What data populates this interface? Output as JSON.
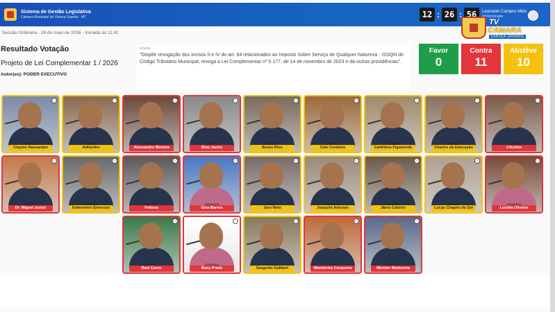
{
  "header": {
    "system_title": "Sistema de Gestão Legislativa",
    "system_subtitle": "Câmara Municipal de Várzea Grande - MT",
    "clock": {
      "h": "12",
      "m": "26",
      "s": "56"
    },
    "user_name": "Leonardo Campos Melo",
    "user_role": "Administrador",
    "tv_label": "TV",
    "tv_camara": "CÂMARA",
    "tv_city": "VÁRZEA GRANDE"
  },
  "session": {
    "info": "Sessão Ordinária - 26 de maio de 2026 - Iniciada às 11:42"
  },
  "vote": {
    "title": "Resultado Votação",
    "bill": "Projeto de Lei Complementar 1 / 2026",
    "author": "Autor(es): PODER EXECUTIVO",
    "ementa_label": "Ementa",
    "ementa": "\"Dispõe revogação dos incisos II e IV do art. 84 relacionados ao Imposto Sobre Serviço de Qualquer Natureza - ISSQN do Código Tributário Municipal, revoga a Lei Complementar nº 5.177, de 14 de novembro de 2023 e dá outras providências\"."
  },
  "tally": [
    {
      "label": "Favor",
      "count": "0",
      "color": "#1e9e4a"
    },
    {
      "label": "Contra",
      "count": "11",
      "color": "#e3353a"
    },
    {
      "label": "Abstêve",
      "count": "10",
      "color": "#f4c20d"
    }
  ],
  "role_label": "Vereador",
  "role_label_f": "Vereadora",
  "members": [
    {
      "name": "Clayton Nassarden",
      "vote": "abst",
      "bg": "#7a8aa8",
      "role": "m"
    },
    {
      "name": "Adilsinho",
      "vote": "abst",
      "bg": "#8b6a52",
      "role": "m"
    },
    {
      "name": "Alessandro Moreira",
      "vote": "contra",
      "bg": "#6b4a3a",
      "role": "m"
    },
    {
      "name": "Braz Jacíro",
      "vote": "contra",
      "bg": "#8a8a8a",
      "role": "m"
    },
    {
      "name": "Bruno Rios",
      "vote": "abst",
      "bg": "#7a6a5a",
      "role": "m"
    },
    {
      "name": "Caio Cordeiro",
      "vote": "abst",
      "bg": "#9a6a3a",
      "role": "m"
    },
    {
      "name": "Carlinhos Figueiredo",
      "vote": "abst",
      "bg": "#a08a6a",
      "role": "m"
    },
    {
      "name": "Charles da Educação",
      "vote": "abst",
      "bg": "#8a7060",
      "role": "m"
    },
    {
      "name": "Cilcinho",
      "vote": "contra",
      "bg": "#7a5a4a",
      "role": "m"
    },
    {
      "name": "Dr. Miguel Junior",
      "vote": "contra",
      "bg": "#c47a4a",
      "role": "m"
    },
    {
      "name": "Enfermeiro Emerson",
      "vote": "abst",
      "bg": "#6a6a6a",
      "role": "m"
    },
    {
      "name": "Feitosa",
      "vote": "contra",
      "bg": "#5a5a5a",
      "role": "m"
    },
    {
      "name": "Gisa Barros",
      "vote": "contra",
      "bg": "#4a78c4",
      "role": "f"
    },
    {
      "name": "Jaro Neto",
      "vote": "abst",
      "bg": "#7a6a6a",
      "role": "m"
    },
    {
      "name": "Joaquim Antunes",
      "vote": "abst",
      "bg": "#9a8a7a",
      "role": "m"
    },
    {
      "name": "Jânio Calistro",
      "vote": "abst",
      "bg": "#6a5a4a",
      "role": "m"
    },
    {
      "name": "Lucas Chapéu do Sol",
      "vote": "abst",
      "bg": "#b0a090",
      "role": "m"
    },
    {
      "name": "Lucélia Oliveira",
      "vote": "contra",
      "bg": "#7a4a3a",
      "role": "f"
    },
    {
      "name": "Raul Curvo",
      "vote": "contra",
      "bg": "#3a7a4a",
      "role": "m"
    },
    {
      "name": "Rosy Prado",
      "vote": "contra",
      "bg": "#ffffff",
      "role": "f"
    },
    {
      "name": "Sargento Galibert",
      "vote": "abst",
      "bg": "#8a7a5a",
      "role": "m"
    },
    {
      "name": "Wanderley Cerqueira",
      "vote": "contra",
      "bg": "#c06a3a",
      "role": "m"
    },
    {
      "name": "Wender Madureira",
      "vote": "contra",
      "bg": "#5a6a8a",
      "role": "m"
    }
  ]
}
